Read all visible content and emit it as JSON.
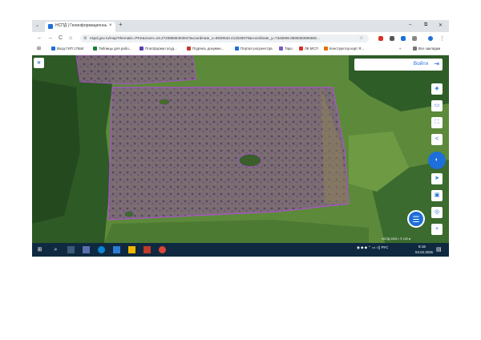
{
  "browser": {
    "tab_title": "НСПД | Геоинформационный",
    "tab_close": "×",
    "new_tab": "+",
    "tab_menu": "⌄",
    "window": {
      "minimize": "–",
      "restore": "⧉",
      "close": "✕"
    },
    "nav": {
      "back": "←",
      "forward": "→",
      "reload": "C",
      "home": "⌂"
    },
    "url": "nspd.gov.ru/map?thematic=PKK&zoom=16.27208865463947&coordinate_x=6930543.413326576&coordinate_y=7345596.856838386568z...",
    "site_icon": "⚙",
    "star": "☆"
  },
  "bookmarks": {
    "apps_icon": "⊞",
    "items": [
      {
        "label": "Вход ГИП 178а0",
        "color": "#1e6fd9"
      },
      {
        "label": "Таблицы для рабо...",
        "color": "#188038"
      },
      {
        "label": "Платформа госуд...",
        "color": "#5b3fb2"
      },
      {
        "label": "Подпись докумен...",
        "color": "#c0392b"
      },
      {
        "label": "Портал росреестра",
        "color": "#1e6fd9"
      },
      {
        "label": "Таро",
        "color": "#7b58c8"
      },
      {
        "label": "ЛК МСП",
        "color": "#d93025"
      },
      {
        "label": "Конструктор карт Я...",
        "color": "#e37400"
      }
    ],
    "more": "»",
    "all_bookmarks": "Все закладки"
  },
  "map": {
    "expand_icon": "»",
    "login_label": "Войти",
    "login_icon": "⇥",
    "tools": [
      {
        "name": "layers-icon",
        "glyph": "◈"
      },
      {
        "name": "ruler-icon",
        "glyph": "▭"
      },
      {
        "name": "fullscreen-icon",
        "glyph": "⛶"
      },
      {
        "name": "share-icon",
        "glyph": "<"
      },
      {
        "name": "search-object-icon",
        "glyph": "◐"
      },
      {
        "name": "location-icon",
        "glyph": "➤"
      },
      {
        "name": "image-icon",
        "glyph": "▣"
      },
      {
        "name": "target-icon",
        "glyph": "◎"
      },
      {
        "name": "zoom-in-icon",
        "glyph": "+"
      }
    ],
    "chat_icon": "☰",
    "attribution": "НСПД 2025 г. ©   100 м"
  },
  "taskbar": {
    "start": "⊞",
    "search": "⌕",
    "tray": "◉ ◆ ◆ ⌃ ▭ ◁) РУС",
    "lang": "РУС",
    "time": "8:16",
    "date": "04.04.2025",
    "notify": "▤"
  },
  "colors": {
    "accent": "#1e6fd9",
    "parcel": "#a64ecb",
    "taskbar": "#0f2a40"
  }
}
